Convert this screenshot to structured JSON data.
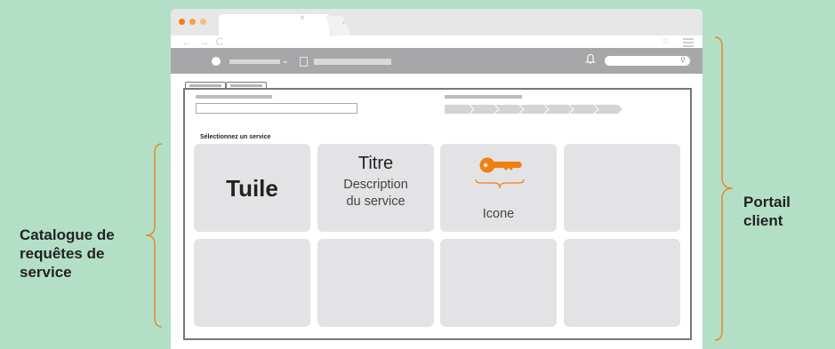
{
  "browser": {
    "tab_close": "×",
    "new_tab": "+",
    "nav_icons": "← → C",
    "star_icon": "☆"
  },
  "header": {
    "bell_icon": "bell",
    "search_icon": "⚲",
    "chevron": "⌄"
  },
  "page": {
    "title": "Sélectionnez un service",
    "tiles": {
      "tuile": "Tuile",
      "titre": "Titre",
      "description": "Description du service",
      "icone": "Icone"
    }
  },
  "annotations": {
    "left": "Catalogue de requêtes de service",
    "right": "Portail client"
  },
  "colors": {
    "background": "#b3dfc6",
    "accent": "#f07f11",
    "tile": "#e3e3e6",
    "header": "#a7a7a9"
  }
}
